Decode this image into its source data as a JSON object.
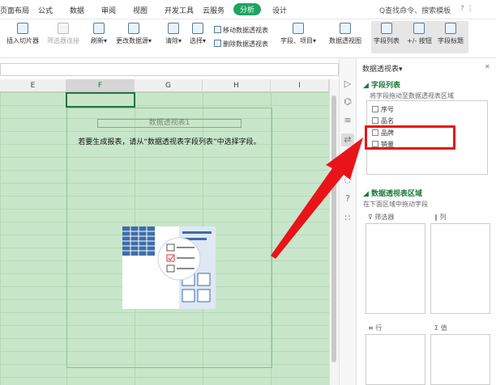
{
  "menu": [
    "页面布局",
    "公式",
    "数据",
    "审阅",
    "视图",
    "开发工具",
    "云服务",
    "分析",
    "设计"
  ],
  "search": "Q查找命令、搜索模板",
  "help": "? ⋮",
  "ribbon": {
    "insert_slicer": "插入切片器",
    "filter_conn": "筛选器连接",
    "refresh": "刷新▾",
    "change_source": "更改数据源▾",
    "clear": "清除▾",
    "select": "选择▾",
    "move_pivot": "移动数据透视表",
    "delete_pivot": "删除数据透视表",
    "fields_items": "字段、项目▾",
    "pivot_chart": "数据透视图",
    "field_list": "字段列表",
    "pm_buttons": "+/- 按钮",
    "field_headers": "字段标题"
  },
  "columns": [
    "E",
    "F",
    "G",
    "H",
    "I"
  ],
  "pivot": {
    "title": "数据透视表1",
    "message": "若要生成报表，请从“数据透视表字段列表”中选择字段。"
  },
  "panel": {
    "title": "数据透视表▾",
    "close": "✕",
    "field_list_header": "◢ 字段列表",
    "drag_hint": "将字段拖动至数据透视表区域",
    "fields": [
      "序号",
      "品名",
      "品牌",
      "销量"
    ],
    "areas_header": "◢ 数据透视表区域",
    "areas_hint": "在下面区域中拖动字段",
    "filter": "筛选器",
    "column": "列",
    "row": "行",
    "value": "值"
  }
}
